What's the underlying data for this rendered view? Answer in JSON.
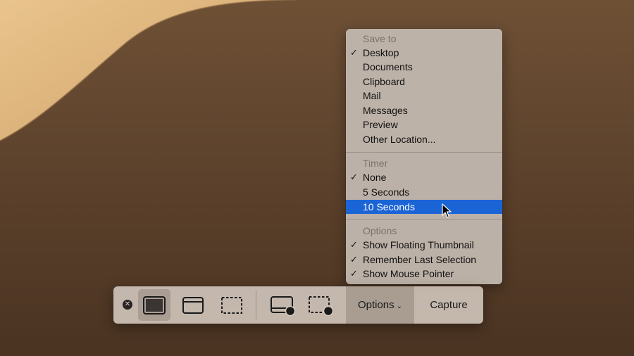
{
  "menu": {
    "save_to": {
      "header": "Save to",
      "items": [
        {
          "label": "Desktop",
          "checked": true
        },
        {
          "label": "Documents",
          "checked": false
        },
        {
          "label": "Clipboard",
          "checked": false
        },
        {
          "label": "Mail",
          "checked": false
        },
        {
          "label": "Messages",
          "checked": false
        },
        {
          "label": "Preview",
          "checked": false
        },
        {
          "label": "Other Location...",
          "checked": false
        }
      ]
    },
    "timer": {
      "header": "Timer",
      "items": [
        {
          "label": "None",
          "checked": true
        },
        {
          "label": "5 Seconds",
          "checked": false
        },
        {
          "label": "10 Seconds",
          "checked": false,
          "highlighted": true
        }
      ]
    },
    "options": {
      "header": "Options",
      "items": [
        {
          "label": "Show Floating Thumbnail",
          "checked": true
        },
        {
          "label": "Remember Last Selection",
          "checked": true
        },
        {
          "label": "Show Mouse Pointer",
          "checked": true
        }
      ]
    },
    "check_glyph": "✓",
    "highlight_color": "#1b64d6"
  },
  "toolbar": {
    "close_glyph": "✕",
    "tools": [
      {
        "icon": "capture-entire-screen-icon",
        "selected": true
      },
      {
        "icon": "capture-window-icon",
        "selected": false
      },
      {
        "icon": "capture-selection-icon",
        "selected": false
      },
      {
        "icon": "record-entire-screen-icon",
        "selected": false
      },
      {
        "icon": "record-selection-icon",
        "selected": false
      }
    ],
    "options_label": "Options",
    "options_chevron": "⌄",
    "capture_label": "Capture"
  }
}
